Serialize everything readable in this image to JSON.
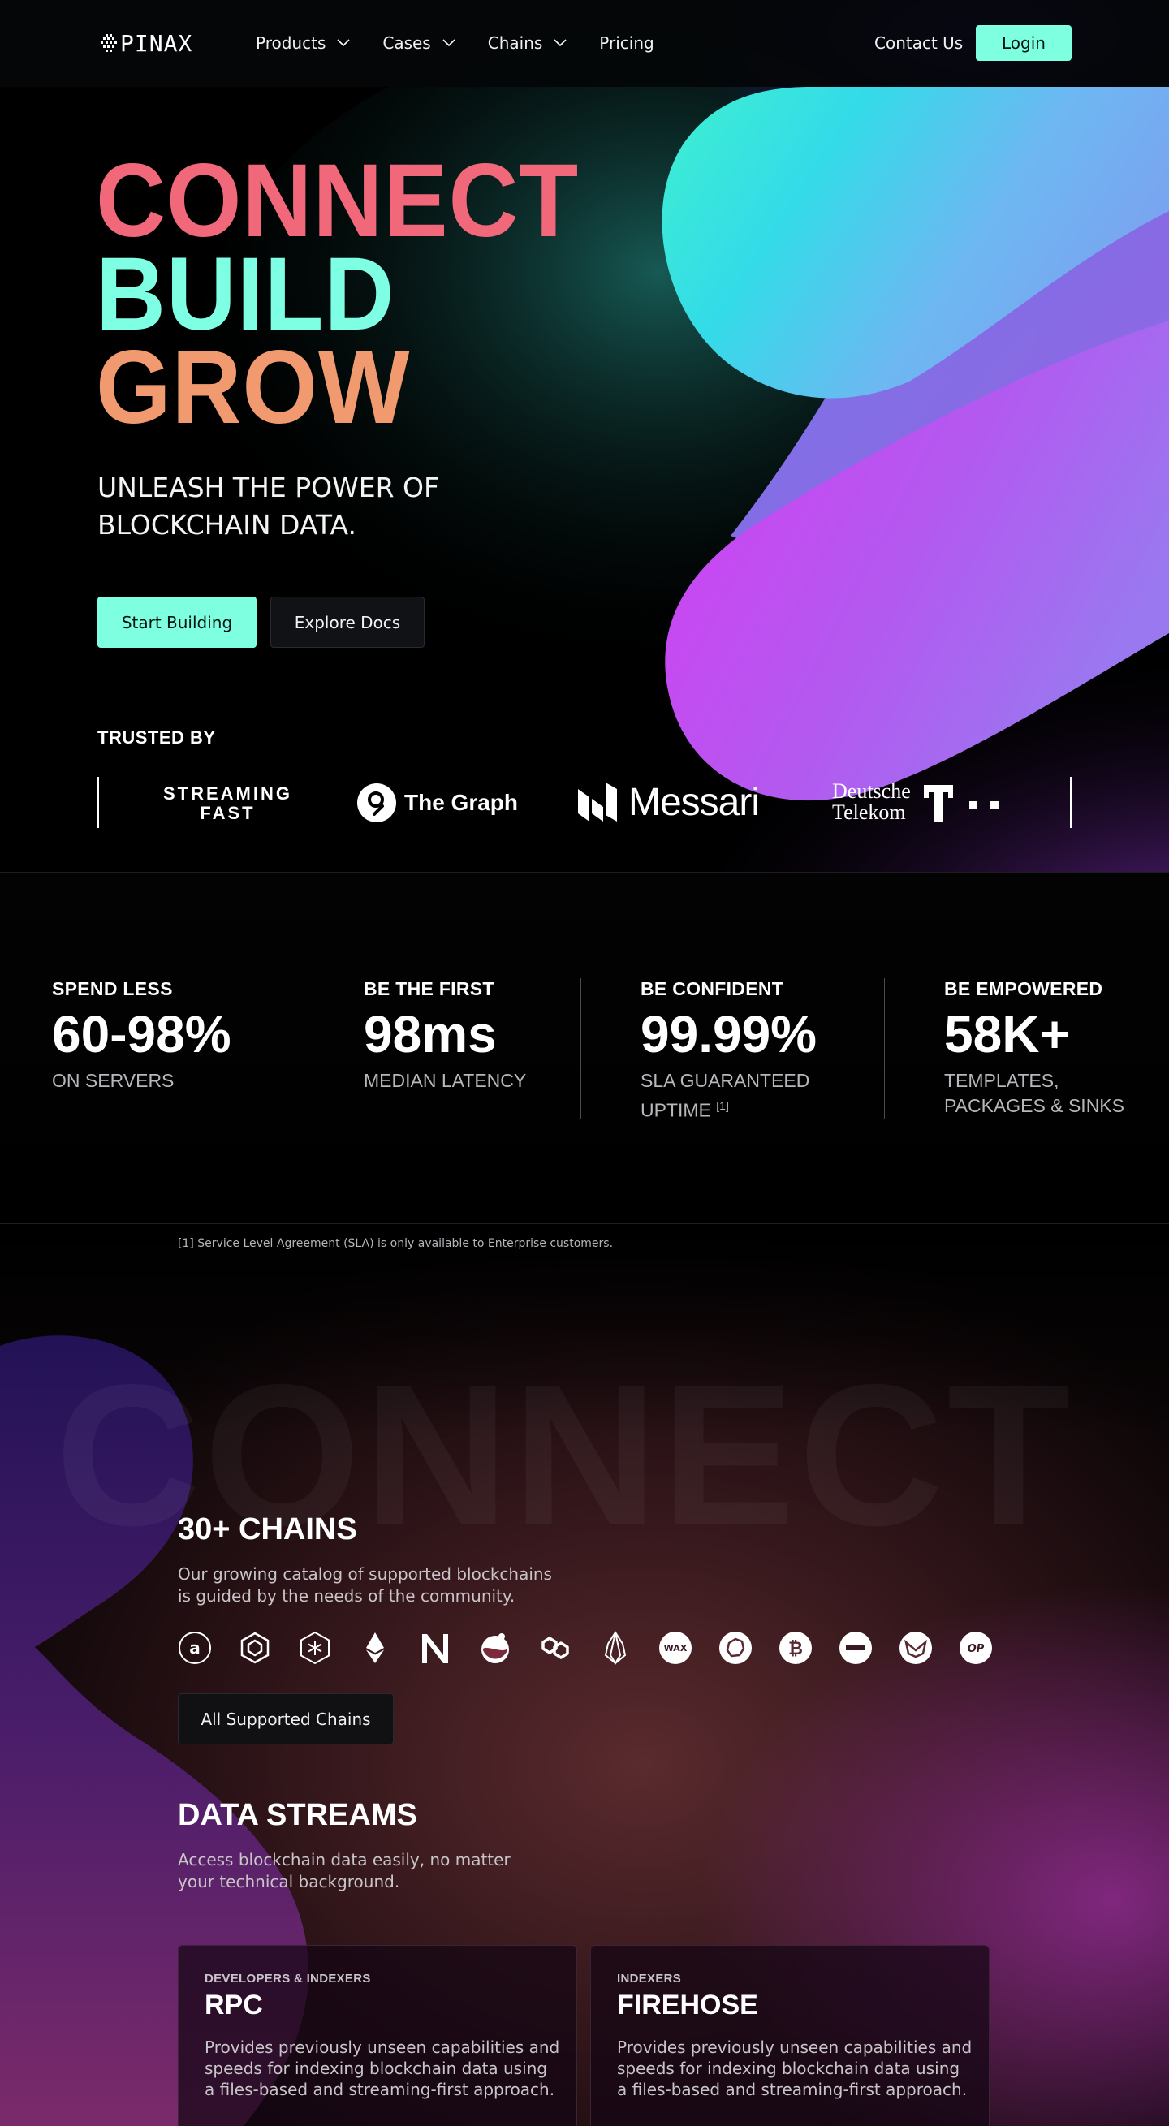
{
  "nav": {
    "logo_text": "PINAX",
    "items": [
      {
        "label": "Products",
        "has_dropdown": true
      },
      {
        "label": "Cases",
        "has_dropdown": true
      },
      {
        "label": "Chains",
        "has_dropdown": true
      },
      {
        "label": "Pricing",
        "has_dropdown": false
      }
    ],
    "contact_label": "Contact Us",
    "login_label": "Login"
  },
  "hero": {
    "title_lines": [
      "CONNECT",
      "BUILD",
      "GROW"
    ],
    "subtitle_line1": "UNLEASH THE POWER OF",
    "subtitle_line2": "BLOCKCHAIN DATA.",
    "primary_button": "Start Building",
    "secondary_button": "Explore Docs",
    "trusted_label": "TRUSTED BY",
    "partners": {
      "streamingfast_line1": "STREAMING",
      "streamingfast_line2": "FAST",
      "thegraph": "The Graph",
      "messari": "Messari",
      "telekom_line1": "Deutsche",
      "telekom_line2": "Telekom"
    }
  },
  "stats": [
    {
      "label": "SPEND LESS",
      "value": "60-98%",
      "desc": "ON SERVERS",
      "desc2": "",
      "sup": ""
    },
    {
      "label": "BE THE FIRST",
      "value": "98ms",
      "desc": "MEDIAN LATENCY",
      "desc2": "",
      "sup": ""
    },
    {
      "label": "BE CONFIDENT",
      "value": "99.99%",
      "desc": "SLA GUARANTEED",
      "desc2": "UPTIME",
      "sup": "[1]"
    },
    {
      "label": "BE EMPOWERED",
      "value": "58K+",
      "desc": "TEMPLATES,",
      "desc2": "PACKAGES & SINKS",
      "sup": ""
    }
  ],
  "footnote": "[1] Service Level Agreement (SLA) is only available to Enterprise customers.",
  "chains_section": {
    "background_word": "CONNECT",
    "title": "30+ CHAINS",
    "desc_line1": "Our growing catalog of supported blockchains",
    "desc_line2": "is guided by the needs of the community.",
    "button": "All Supported Chains",
    "chain_icons": [
      "antelope-icon",
      "bnb-icon",
      "polkadot-icon",
      "ethereum-icon",
      "near-icon",
      "flask-icon",
      "polygon-icon",
      "eos-icon",
      "wax-icon",
      "arbitrum-icon",
      "bitcoin-icon",
      "minus-chain-icon",
      "ux-icon",
      "optimism-icon"
    ],
    "wax_label": "WAX",
    "op_label": "OP"
  },
  "streams_section": {
    "title": "DATA STREAMS",
    "desc_line1": "Access blockchain data easily, no matter",
    "desc_line2": "your technical background.",
    "cards": [
      {
        "eyebrow": "DEVELOPERS & INDEXERS",
        "title": "RPC",
        "body": "Provides previously unseen capabilities and speeds for indexing blockchain data using a files-based and streaming-first approach."
      },
      {
        "eyebrow": "INDEXERS",
        "title": "FIREHOSE",
        "body": "Provides previously unseen capabilities and speeds for indexing blockchain data using a files-based and streaming-first approach."
      }
    ]
  },
  "colors": {
    "accent_mint": "#7dffe0",
    "title_pink": "#f0687a",
    "title_orange": "#f19a6f"
  }
}
